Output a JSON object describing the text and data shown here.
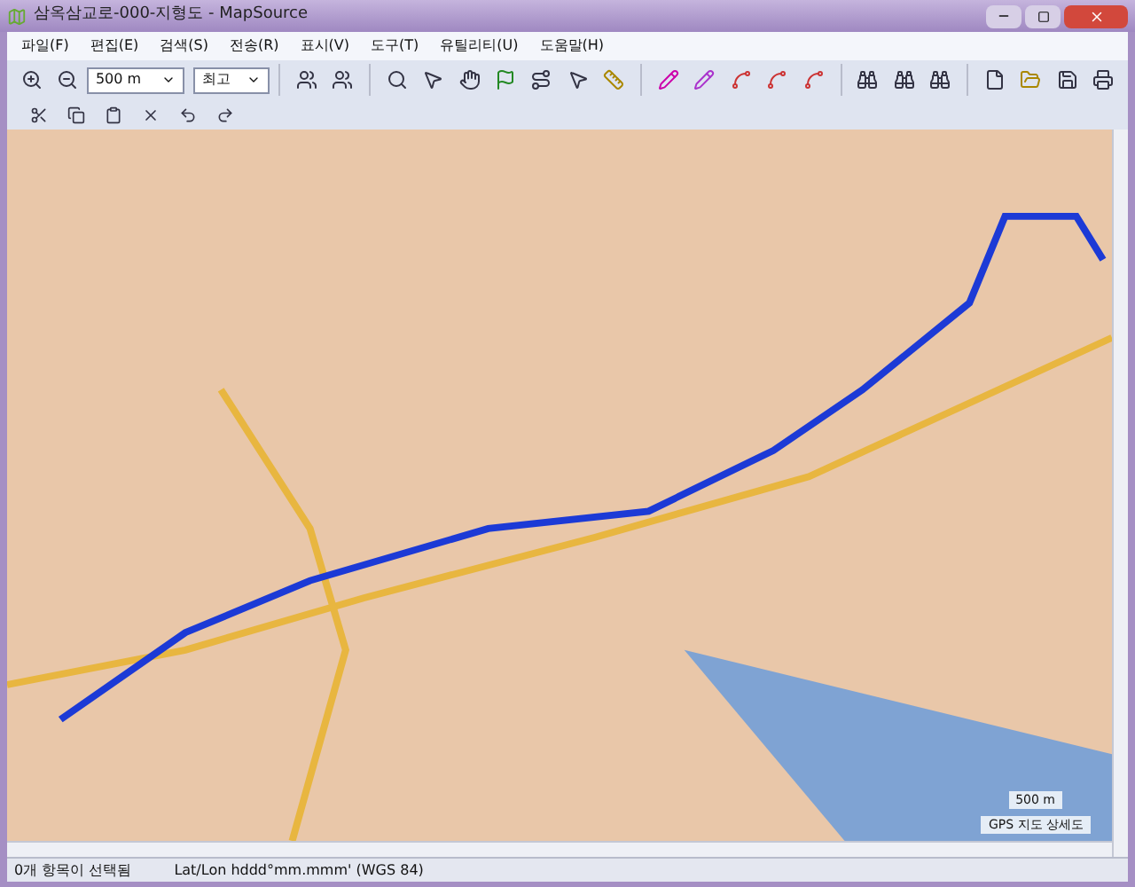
{
  "window": {
    "title": "삼옥삼교로-000-지형도 - MapSource"
  },
  "menu": [
    "파일(F)",
    "편집(E)",
    "검색(S)",
    "전송(R)",
    "표시(V)",
    "도구(T)",
    "유틸리티(U)",
    "도움말(H)"
  ],
  "toolbar": {
    "zoom_scale": "500 m",
    "detail": "최고"
  },
  "map": {
    "scale_label": "500 m",
    "map_name": "GPS 지도 상세도"
  },
  "status_bar": {
    "selection": "0개 항목이 선택됨",
    "coordinates": "Lat/Lon hddd°mm.mmm' (WGS 84)"
  }
}
